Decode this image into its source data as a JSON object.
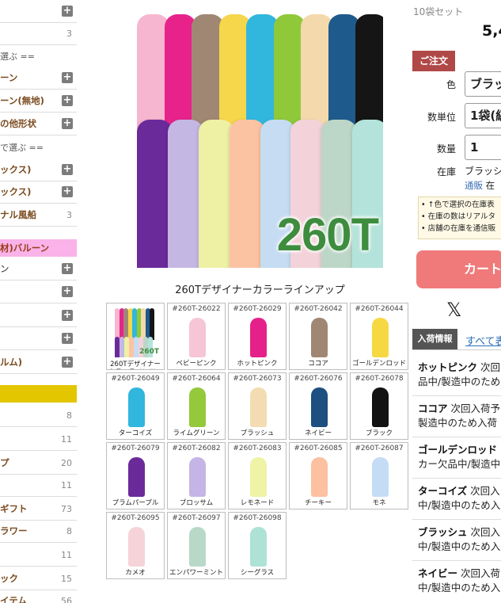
{
  "sidebar": {
    "items": [
      {
        "label": "",
        "kind": "plus",
        "top": 0
      },
      {
        "label": "",
        "count": "3"
      },
      {
        "label": "選ぶ ==",
        "kind": "section"
      },
      {
        "label": "ーン",
        "kind": "bold-plus"
      },
      {
        "label": "ーン(無地)",
        "kind": "bold-plus"
      },
      {
        "label": "の他形状",
        "kind": "bold-plus"
      },
      {
        "label": "で選ぶ ==",
        "kind": "section"
      },
      {
        "label": "ックス)",
        "kind": "bold-plus"
      },
      {
        "label": "ックス)",
        "kind": "bold-plus"
      },
      {
        "label": "ナル風船",
        "kind": "bold",
        "count": "3"
      },
      {
        "label": "材)バルーン",
        "kind": "pink"
      },
      {
        "label": "ン",
        "kind": "plus"
      },
      {
        "label": "",
        "kind": "plus"
      },
      {
        "label": "",
        "kind": "plus"
      },
      {
        "label": "",
        "kind": "plus"
      },
      {
        "label": "ルム)",
        "kind": "bold-plus"
      },
      {
        "label": "",
        "kind": "yellow"
      },
      {
        "label": "",
        "count": "8"
      },
      {
        "label": "",
        "count": "11"
      },
      {
        "label": "プ",
        "kind": "bold",
        "count": "20"
      },
      {
        "label": "",
        "count": "11"
      },
      {
        "label": "ギフト",
        "kind": "bold",
        "count": "73"
      },
      {
        "label": "ラワー",
        "kind": "bold",
        "count": "8"
      },
      {
        "label": "",
        "count": "11"
      },
      {
        "label": "ック",
        "kind": "bold",
        "count": "15"
      },
      {
        "label": "イテム",
        "kind": "bold",
        "count": "56"
      }
    ]
  },
  "hero": {
    "title_text": "260T",
    "caption": "260Tデザイナーカラーラインアップ",
    "top_row_colors": [
      "#f6b6cf",
      "#e7238b",
      "#a08774",
      "#f6d64a",
      "#31b7de",
      "#8fc93a",
      "#f3d9ac",
      "#1f5a8c",
      "#151515"
    ],
    "bottom_row_colors": [
      "#6b2a9a",
      "#c4b7e3",
      "#eef0a3",
      "#fcc3a3",
      "#c6dcf3",
      "#f3d2d9",
      "#bcd6c7",
      "#b3e3da"
    ]
  },
  "swatches": [
    {
      "code": "",
      "name": "260Tデザイナーカラーラインアップ",
      "color": "",
      "thumb": true
    },
    {
      "code": "#260T-26022",
      "name": "ベビーピンク",
      "color": "#f6c5d6"
    },
    {
      "code": "#260T-26029",
      "name": "ホットピンク",
      "color": "#e5208a"
    },
    {
      "code": "#260T-26042",
      "name": "ココア",
      "color": "#a08774"
    },
    {
      "code": "#260T-26044",
      "name": "ゴールデンロッド",
      "color": "#f6d843"
    },
    {
      "code": "#260T-26049",
      "name": "ターコイズ",
      "color": "#31b6dd"
    },
    {
      "code": "#260T-26064",
      "name": "ライムグリーン",
      "color": "#93c93a"
    },
    {
      "code": "#260T-26073",
      "name": "ブラッシュ",
      "color": "#f4dcb2"
    },
    {
      "code": "#260T-26076",
      "name": "ネイビー",
      "color": "#1d4f80"
    },
    {
      "code": "#260T-26078",
      "name": "ブラック",
      "color": "#121212"
    },
    {
      "code": "#260T-26079",
      "name": "プラムパープル",
      "color": "#6b2a9a"
    },
    {
      "code": "#260T-26082",
      "name": "ブロッサム",
      "color": "#c4b5e6"
    },
    {
      "code": "#260T-26083",
      "name": "レモネード",
      "color": "#eff3a6"
    },
    {
      "code": "#260T-26085",
      "name": "チーキー",
      "color": "#fdc0a0"
    },
    {
      "code": "#260T-26087",
      "name": "モネ",
      "color": "#c5dcf5"
    },
    {
      "code": "#260T-26095",
      "name": "カメオ",
      "color": "#f5d3d9"
    },
    {
      "code": "#260T-26097",
      "name": "エンパワーミント",
      "color": "#b8d8c8"
    },
    {
      "code": "#260T-26098",
      "name": "シーグラス",
      "color": "#aee2d7"
    }
  ],
  "order": {
    "set_label": "10袋セット",
    "price": "5,4",
    "badge": "ご注文",
    "color_label": "色",
    "color_value": "ブラッ",
    "unit_label": "数単位",
    "unit_value": "1袋(級",
    "qty_label": "数量",
    "qty_value": "1",
    "stock_label": "在庫",
    "stock_value": "ブラッシ",
    "stock_sub_a": "通販",
    "stock_sub_b": "在",
    "notice_lines": [
      "• ↑色で選択の在庫表",
      "• 在庫の数はリアルタ",
      "• 店舗の在庫を通信販"
    ],
    "cart_label": "カート",
    "x_icon": "𝕏"
  },
  "arrival": {
    "tab_active": "入荷情報",
    "tab_link": "すべて表",
    "items": [
      {
        "title": "ホットピンク",
        "text1": "次回",
        "text2": "品中/製造中のため"
      },
      {
        "title": "ココア",
        "text1": "次回入荷予",
        "text2": "製造中のため入荷"
      },
      {
        "title": "ゴールデンロッド",
        "text1": "",
        "text2": "カー欠品中/製造中"
      },
      {
        "title": "ターコイズ",
        "text1": "次回入",
        "text2": "中/製造中のため入"
      },
      {
        "title": "ブラッシュ",
        "text1": "次回入",
        "text2": "中/製造中のため入"
      },
      {
        "title": "ネイビー",
        "text1": "次回入荷",
        "text2": "中/製造中のため入"
      }
    ]
  }
}
